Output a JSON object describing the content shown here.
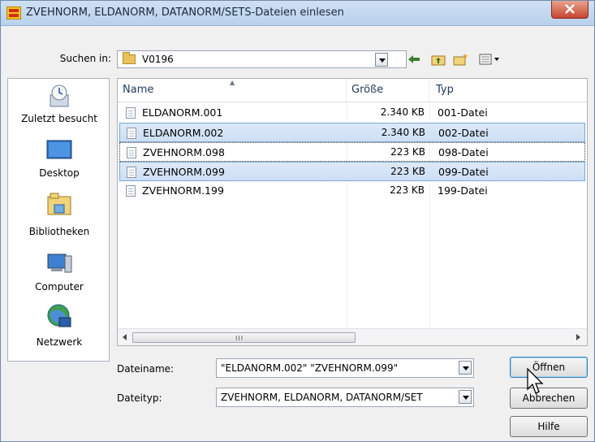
{
  "window": {
    "title": "ZVEHNORM, ELDANORM, DATANORM/SETS-Dateien einlesen"
  },
  "lookin": {
    "label": "Suchen in:",
    "value": "V0196"
  },
  "toolbar": {
    "icons": [
      "back-icon",
      "up-folder-icon",
      "new-folder-icon",
      "view-menu-icon"
    ]
  },
  "places": [
    {
      "label": "Zuletzt besucht",
      "icon": "recent-icon"
    },
    {
      "label": "Desktop",
      "icon": "desktop-icon"
    },
    {
      "label": "Bibliotheken",
      "icon": "libraries-icon"
    },
    {
      "label": "Computer",
      "icon": "computer-icon"
    },
    {
      "label": "Netzwerk",
      "icon": "network-icon"
    }
  ],
  "list": {
    "columns": [
      "Name",
      "Größe",
      "Typ"
    ],
    "files": [
      {
        "name": "ELDANORM.001",
        "size": "2.340 KB",
        "type": "001-Datei",
        "selected": false
      },
      {
        "name": "ELDANORM.002",
        "size": "2.340 KB",
        "type": "002-Datei",
        "selected": true
      },
      {
        "name": "ZVEHNORM.098",
        "size": "223 KB",
        "type": "098-Datei",
        "selected": false
      },
      {
        "name": "ZVEHNORM.099",
        "size": "223 KB",
        "type": "099-Datei",
        "selected": true
      },
      {
        "name": "ZVEHNORM.199",
        "size": "223 KB",
        "type": "199-Datei",
        "selected": false
      }
    ],
    "scroll_grip": "III"
  },
  "filename": {
    "label": "Dateiname:",
    "value": "\"ELDANORM.002\" \"ZVEHNORM.099\""
  },
  "filetype": {
    "label": "Dateityp:",
    "value": "ZVEHNORM, ELDANORM, DATANORM/SET"
  },
  "buttons": {
    "open": "Öffnen",
    "cancel": "Abbrechen",
    "help": "Hilfe"
  },
  "colors": {
    "selection": "#cddff5",
    "selection_border": "#7fa6d1",
    "titlebar": "#b9d1ec",
    "close": "#c74531"
  }
}
